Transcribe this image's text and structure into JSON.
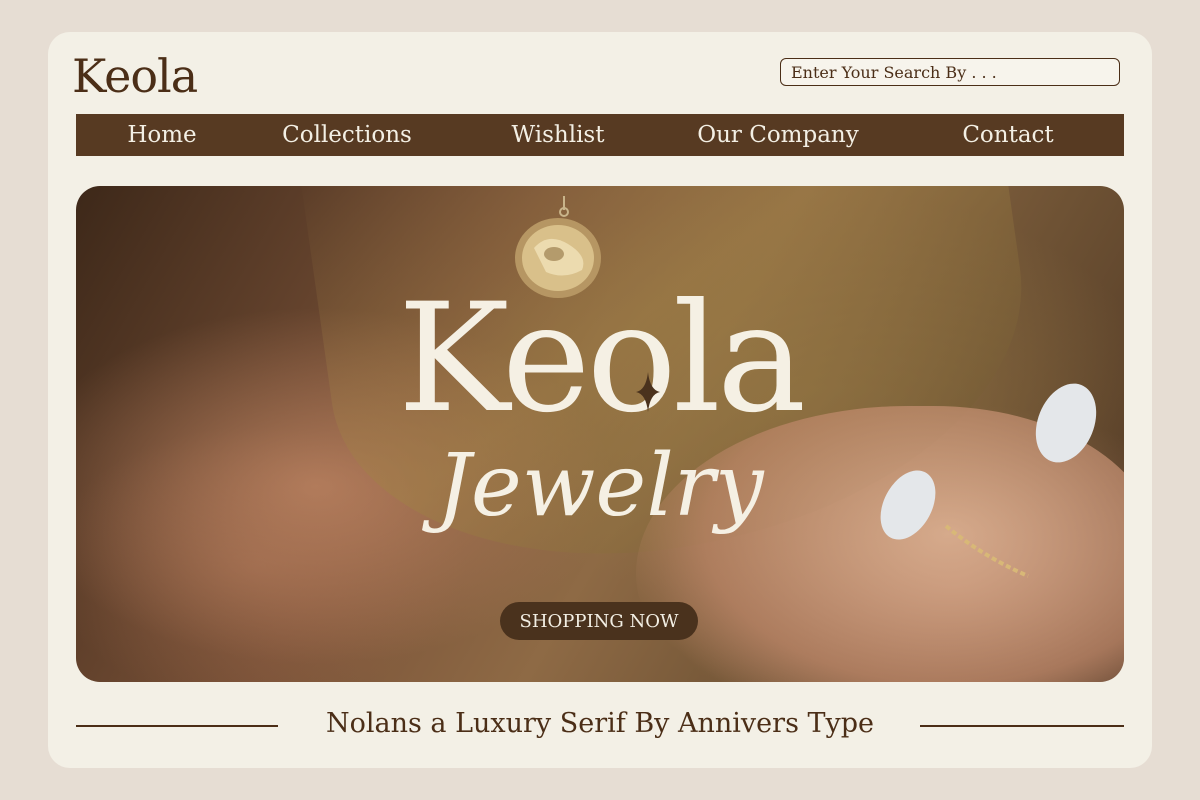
{
  "header": {
    "logo": "Keola",
    "search": {
      "placeholder": "Enter Your Search By . . .",
      "value": ""
    }
  },
  "nav": {
    "items": [
      {
        "label": "Home"
      },
      {
        "label": "Collections"
      },
      {
        "label": "Wishlist"
      },
      {
        "label": "Our Company"
      },
      {
        "label": "Contact"
      }
    ]
  },
  "hero": {
    "title": "Keola",
    "subtitle": "Jewelry",
    "cta_label": "SHOPPING NOW",
    "image_subject": "hand-with-pendant-necklace-and-ring"
  },
  "footer": {
    "tagline": "Nolans a Luxury Serif By Annivers Type"
  },
  "colors": {
    "page_background": "#e6ddd3",
    "card_background": "#f3f0e6",
    "primary_brown": "#573a22",
    "text_brown": "#4b2e17",
    "hero_text": "#f5f0e4"
  },
  "icons": [
    "sparkle-icon"
  ]
}
